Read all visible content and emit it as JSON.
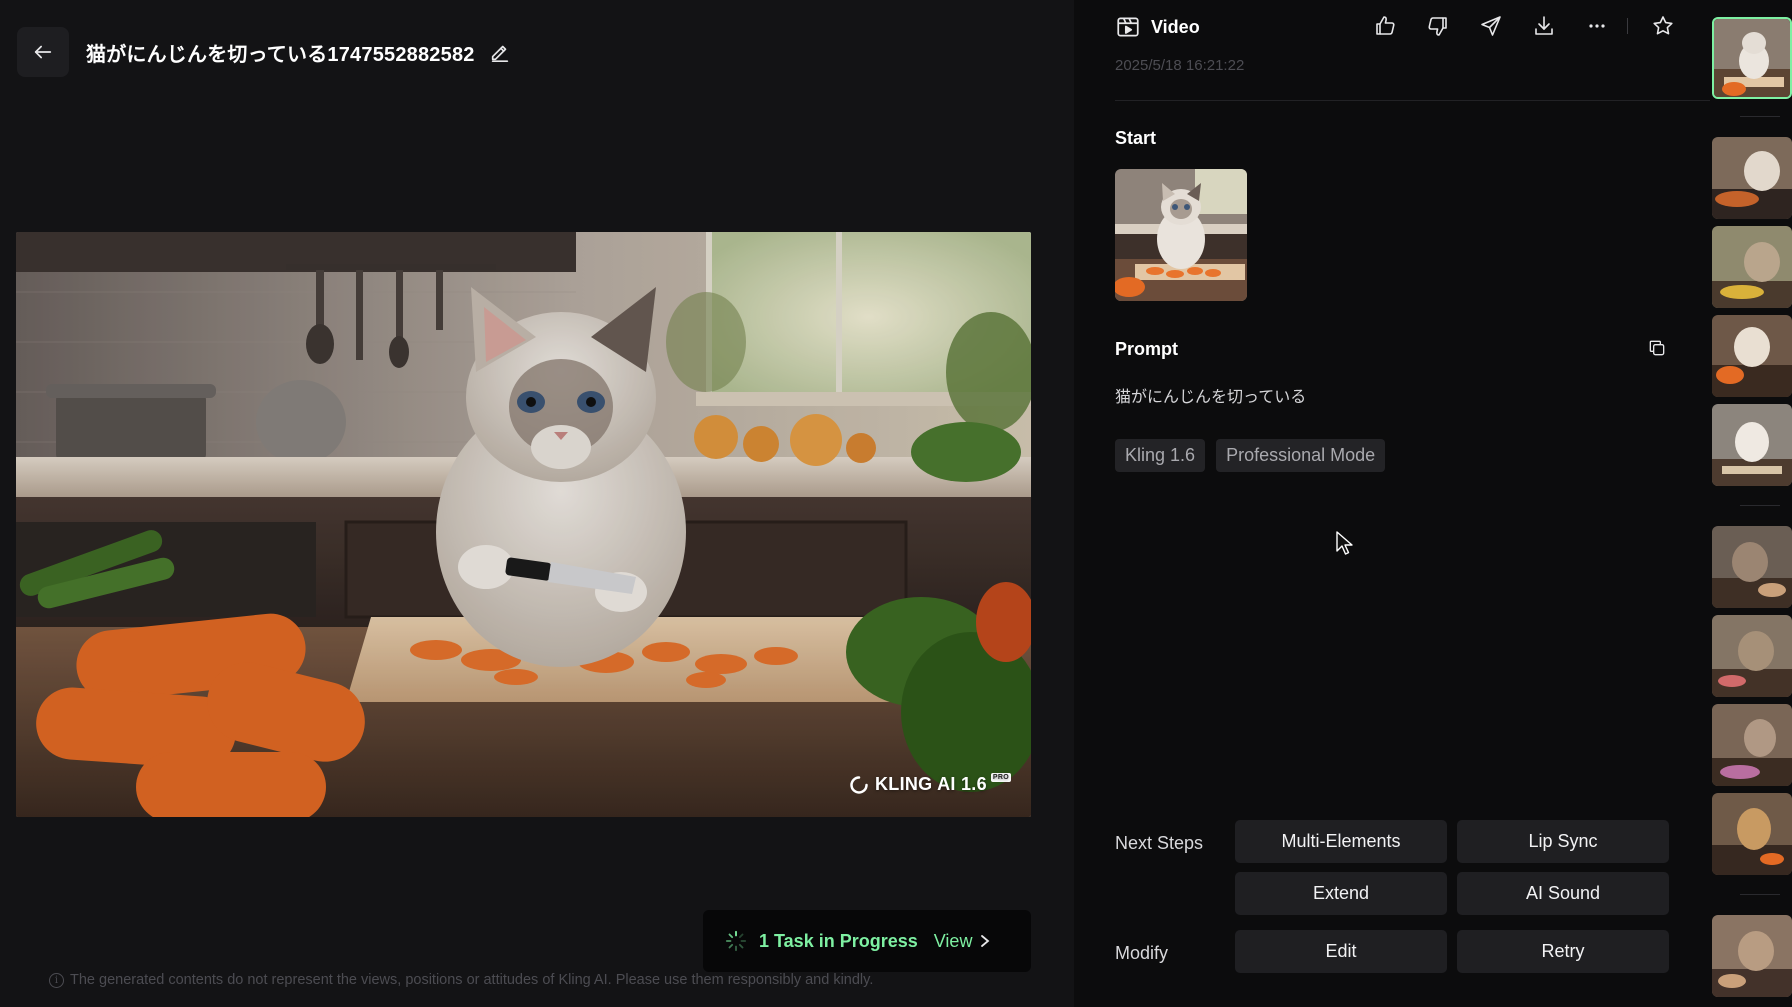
{
  "header": {
    "title": "猫がにんじんを切っている1747552882582",
    "back_icon": "arrow-left-icon",
    "edit_icon": "pencil-icon"
  },
  "video": {
    "watermark": "KLING AI 1.6",
    "watermark_badge": "PRO",
    "description_icon": "video-frame"
  },
  "task_toast": {
    "text": "1 Task in Progress",
    "view_label": "View",
    "accent": "#7ef0a2"
  },
  "disclaimer": "The generated contents do not represent the views, positions or attitudes of Kling AI. Please use them responsibly and kindly.",
  "panel": {
    "type_label": "Video",
    "timestamp": "2025/5/18 16:21:22",
    "actions": [
      "thumbs-up-icon",
      "thumbs-down-icon",
      "send-icon",
      "download-icon",
      "more-icon",
      "star-icon"
    ],
    "start_label": "Start",
    "prompt_label": "Prompt",
    "prompt_text": "猫がにんじんを切っている",
    "tags": [
      "Kling 1.6",
      "Professional Mode"
    ],
    "next_steps_label": "Next Steps",
    "modify_label": "Modify",
    "buttons": {
      "multi_elements": "Multi-Elements",
      "lip_sync": "Lip Sync",
      "extend": "Extend",
      "ai_sound": "AI Sound",
      "edit": "Edit",
      "retry": "Retry"
    }
  },
  "rail": {
    "thumbnail_count": 10,
    "active_index": 0
  }
}
